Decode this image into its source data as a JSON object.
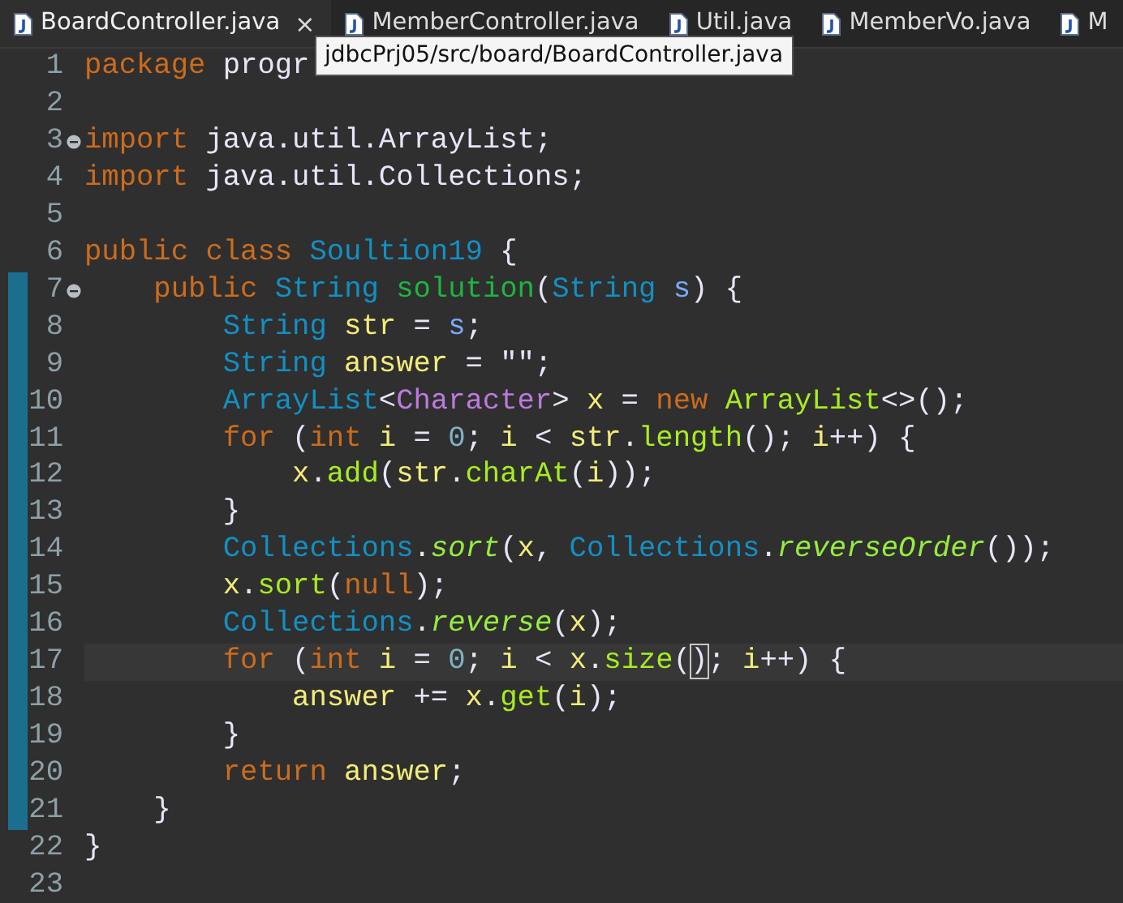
{
  "tabs": [
    {
      "label": "BoardController.java",
      "selected": true,
      "close": "×"
    },
    {
      "label": "MemberController.java",
      "selected": false
    },
    {
      "label": "Util.java",
      "selected": false
    },
    {
      "label": "MemberVo.java",
      "selected": false
    },
    {
      "label": "M",
      "selected": false
    }
  ],
  "tooltip": "jdbcPrj05/src/board/BoardController.java",
  "lines": [
    {
      "number": "1",
      "fold": false,
      "changed": false,
      "current": false,
      "segments": [
        {
          "text": "package",
          "kind": "kw"
        },
        {
          "text": " progr",
          "kind": "plain"
        }
      ]
    },
    {
      "number": "2",
      "fold": false,
      "changed": false,
      "current": false
    },
    {
      "number": "3",
      "fold": true,
      "changed": false,
      "current": false,
      "segments": [
        {
          "text": "import",
          "kind": "kw"
        },
        {
          "text": " java.util.ArrayList;",
          "kind": "plain"
        }
      ]
    },
    {
      "number": "4",
      "fold": false,
      "changed": false,
      "current": false,
      "segments": [
        {
          "text": "import",
          "kind": "kw"
        },
        {
          "text": " java.util.Collections;",
          "kind": "plain"
        }
      ]
    },
    {
      "number": "5",
      "fold": false,
      "changed": false,
      "current": false
    },
    {
      "number": "6",
      "fold": false,
      "changed": false,
      "current": false,
      "segments": [
        {
          "text": "public class",
          "kind": "kw"
        },
        {
          "text": " Soultion19",
          "kind": "type"
        },
        {
          "text": " {",
          "kind": "plain"
        }
      ]
    },
    {
      "number": "7",
      "fold": true,
      "changed": true,
      "current": false,
      "segments": [
        {
          "text": "    public",
          "kind": "kw"
        },
        {
          "text": " String",
          "kind": "type"
        },
        {
          "text": " solution",
          "kind": "decl"
        },
        {
          "text": "(",
          "kind": "plain"
        },
        {
          "text": "String",
          "kind": "type"
        },
        {
          "text": " s",
          "kind": "param"
        },
        {
          "text": ") {",
          "kind": "plain"
        }
      ]
    },
    {
      "number": "8",
      "fold": false,
      "changed": true,
      "current": false,
      "segments": [
        {
          "text": "        String",
          "kind": "type"
        },
        {
          "text": " str",
          "kind": "local"
        },
        {
          "text": " = ",
          "kind": "plain"
        },
        {
          "text": "s",
          "kind": "param"
        },
        {
          "text": ";",
          "kind": "plain"
        }
      ]
    },
    {
      "number": "9",
      "fold": false,
      "changed": true,
      "current": false,
      "segments": [
        {
          "text": "        String",
          "kind": "type"
        },
        {
          "text": " answer",
          "kind": "local"
        },
        {
          "text": " = \"\";",
          "kind": "plain"
        }
      ]
    },
    {
      "number": "10",
      "fold": false,
      "changed": true,
      "current": false,
      "segments": [
        {
          "text": "        ArrayList",
          "kind": "type"
        },
        {
          "text": "<",
          "kind": "plain"
        },
        {
          "text": "Character",
          "kind": "generic"
        },
        {
          "text": "> ",
          "kind": "plain"
        },
        {
          "text": "x",
          "kind": "local"
        },
        {
          "text": " = ",
          "kind": "plain"
        },
        {
          "text": "new",
          "kind": "kw"
        },
        {
          "text": " ArrayList",
          "kind": "call"
        },
        {
          "text": "<>();",
          "kind": "plain"
        }
      ]
    },
    {
      "number": "11",
      "fold": false,
      "changed": true,
      "current": false,
      "segments": [
        {
          "text": "        for",
          "kind": "kw"
        },
        {
          "text": " (",
          "kind": "plain"
        },
        {
          "text": "int",
          "kind": "kw"
        },
        {
          "text": " i",
          "kind": "local"
        },
        {
          "text": " = ",
          "kind": "plain"
        },
        {
          "text": "0",
          "kind": "num"
        },
        {
          "text": "; ",
          "kind": "plain"
        },
        {
          "text": "i",
          "kind": "local"
        },
        {
          "text": " < ",
          "kind": "plain"
        },
        {
          "text": "str",
          "kind": "local"
        },
        {
          "text": ".",
          "kind": "plain"
        },
        {
          "text": "length",
          "kind": "call"
        },
        {
          "text": "(); ",
          "kind": "plain"
        },
        {
          "text": "i",
          "kind": "local"
        },
        {
          "text": "++) {",
          "kind": "plain"
        }
      ]
    },
    {
      "number": "12",
      "fold": false,
      "changed": true,
      "current": false,
      "segments": [
        {
          "text": "            x",
          "kind": "local"
        },
        {
          "text": ".",
          "kind": "plain"
        },
        {
          "text": "add",
          "kind": "call"
        },
        {
          "text": "(",
          "kind": "plain"
        },
        {
          "text": "str",
          "kind": "local"
        },
        {
          "text": ".",
          "kind": "plain"
        },
        {
          "text": "charAt",
          "kind": "call"
        },
        {
          "text": "(",
          "kind": "plain"
        },
        {
          "text": "i",
          "kind": "local"
        },
        {
          "text": "));",
          "kind": "plain"
        }
      ]
    },
    {
      "number": "13",
      "fold": false,
      "changed": true,
      "current": false,
      "segments": [
        {
          "text": "        }",
          "kind": "plain"
        }
      ]
    },
    {
      "number": "14",
      "fold": false,
      "changed": true,
      "current": false,
      "segments": [
        {
          "text": "        Collections",
          "kind": "type"
        },
        {
          "text": ".",
          "kind": "plain"
        },
        {
          "text": "sort",
          "kind": "static"
        },
        {
          "text": "(",
          "kind": "plain"
        },
        {
          "text": "x",
          "kind": "local"
        },
        {
          "text": ", ",
          "kind": "plain"
        },
        {
          "text": "Collections",
          "kind": "type"
        },
        {
          "text": ".",
          "kind": "plain"
        },
        {
          "text": "reverseOrder",
          "kind": "static"
        },
        {
          "text": "());",
          "kind": "plain"
        }
      ]
    },
    {
      "number": "15",
      "fold": false,
      "changed": true,
      "current": false,
      "segments": [
        {
          "text": "        x",
          "kind": "local"
        },
        {
          "text": ".",
          "kind": "plain"
        },
        {
          "text": "sort",
          "kind": "call"
        },
        {
          "text": "(",
          "kind": "plain"
        },
        {
          "text": "null",
          "kind": "kw"
        },
        {
          "text": ");",
          "kind": "plain"
        }
      ]
    },
    {
      "number": "16",
      "fold": false,
      "changed": true,
      "current": false,
      "segments": [
        {
          "text": "        Collections",
          "kind": "type"
        },
        {
          "text": ".",
          "kind": "plain"
        },
        {
          "text": "reverse",
          "kind": "static"
        },
        {
          "text": "(",
          "kind": "plain"
        },
        {
          "text": "x",
          "kind": "local"
        },
        {
          "text": ");",
          "kind": "plain"
        }
      ]
    },
    {
      "number": "17",
      "fold": false,
      "changed": true,
      "current": true,
      "segments": [
        {
          "text": "        for",
          "kind": "kw"
        },
        {
          "text": " (",
          "kind": "plain"
        },
        {
          "text": "int",
          "kind": "kw"
        },
        {
          "text": " i",
          "kind": "local"
        },
        {
          "text": " = ",
          "kind": "plain"
        },
        {
          "text": "0",
          "kind": "num"
        },
        {
          "text": "; ",
          "kind": "plain"
        },
        {
          "text": "i",
          "kind": "local"
        },
        {
          "text": " < ",
          "kind": "plain"
        },
        {
          "text": "x",
          "kind": "local"
        },
        {
          "text": ".",
          "kind": "plain"
        },
        {
          "text": "size",
          "kind": "call"
        },
        {
          "text": "(",
          "kind": "plain"
        },
        {
          "text": ")",
          "kind": "match"
        },
        {
          "text": "; ",
          "kind": "plain"
        },
        {
          "text": "i",
          "kind": "local"
        },
        {
          "text": "++) {",
          "kind": "plain"
        }
      ]
    },
    {
      "number": "18",
      "fold": false,
      "changed": true,
      "current": false,
      "segments": [
        {
          "text": "            answer",
          "kind": "local"
        },
        {
          "text": " += ",
          "kind": "plain"
        },
        {
          "text": "x",
          "kind": "local"
        },
        {
          "text": ".",
          "kind": "plain"
        },
        {
          "text": "get",
          "kind": "call"
        },
        {
          "text": "(",
          "kind": "plain"
        },
        {
          "text": "i",
          "kind": "local"
        },
        {
          "text": ");",
          "kind": "plain"
        }
      ]
    },
    {
      "number": "19",
      "fold": false,
      "changed": true,
      "current": false,
      "segments": [
        {
          "text": "        }",
          "kind": "plain"
        }
      ]
    },
    {
      "number": "20",
      "fold": false,
      "changed": true,
      "current": false,
      "segments": [
        {
          "text": "        return",
          "kind": "kw"
        },
        {
          "text": " answer",
          "kind": "local"
        },
        {
          "text": ";",
          "kind": "plain"
        }
      ]
    },
    {
      "number": "21",
      "fold": false,
      "changed": true,
      "current": false,
      "segments": [
        {
          "text": "    }",
          "kind": "plain"
        }
      ]
    },
    {
      "number": "22",
      "fold": false,
      "changed": false,
      "current": false,
      "segments": [
        {
          "text": "}",
          "kind": "plain"
        }
      ]
    },
    {
      "number": "23",
      "fold": false,
      "changed": false,
      "current": false
    }
  ]
}
